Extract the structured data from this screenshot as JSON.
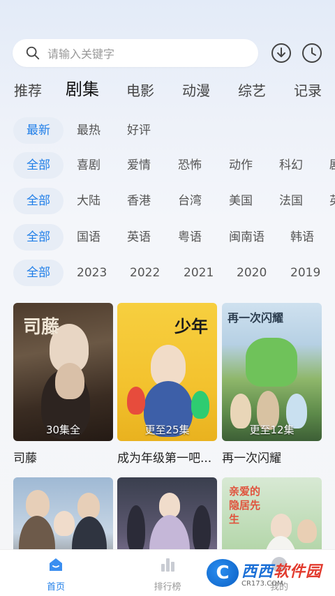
{
  "search": {
    "placeholder": "请输入关键字"
  },
  "categories": [
    "推荐",
    "剧集",
    "电影",
    "动漫",
    "综艺",
    "记录"
  ],
  "active_category": "剧集",
  "filters": {
    "sort": [
      "最新",
      "最热",
      "好评"
    ],
    "genre": [
      "全部",
      "喜剧",
      "爱情",
      "恐怖",
      "动作",
      "科幻",
      "剧"
    ],
    "region": [
      "全部",
      "大陆",
      "香港",
      "台湾",
      "美国",
      "法国",
      "英"
    ],
    "language": [
      "全部",
      "国语",
      "英语",
      "粤语",
      "闽南语",
      "韩语"
    ],
    "year": [
      "全部",
      "2023",
      "2022",
      "2021",
      "2020",
      "2019"
    ]
  },
  "items": [
    {
      "title": "司藤",
      "badge": "30集全",
      "poster_text": "司藤",
      "color": "#4d3b2c"
    },
    {
      "title": "成为年级第一吧...",
      "badge": "更至25集",
      "poster_text": "少年",
      "color": "#f3c22e"
    },
    {
      "title": "再一次闪耀",
      "badge": "更至12集",
      "poster_text": "再一次闪耀",
      "color": "#8fb76b"
    },
    {
      "title": "",
      "badge": "",
      "poster_text": "",
      "color": "#9fb9d4"
    },
    {
      "title": "",
      "badge": "",
      "poster_text": "",
      "color": "#5c5870"
    },
    {
      "title": "",
      "badge": "",
      "poster_text": "亲爱的隐居先生",
      "color": "#b9d9b0"
    }
  ],
  "nav": {
    "home": "首页",
    "ranking": "排行榜",
    "mine": "我的"
  },
  "watermark": {
    "logo": "C",
    "brand_a": "西西",
    "brand_b": "软件园",
    "url": "CR173.COM"
  },
  "colors": {
    "accent": "#1f7ee8",
    "chip_bg": "#e7edf6"
  }
}
